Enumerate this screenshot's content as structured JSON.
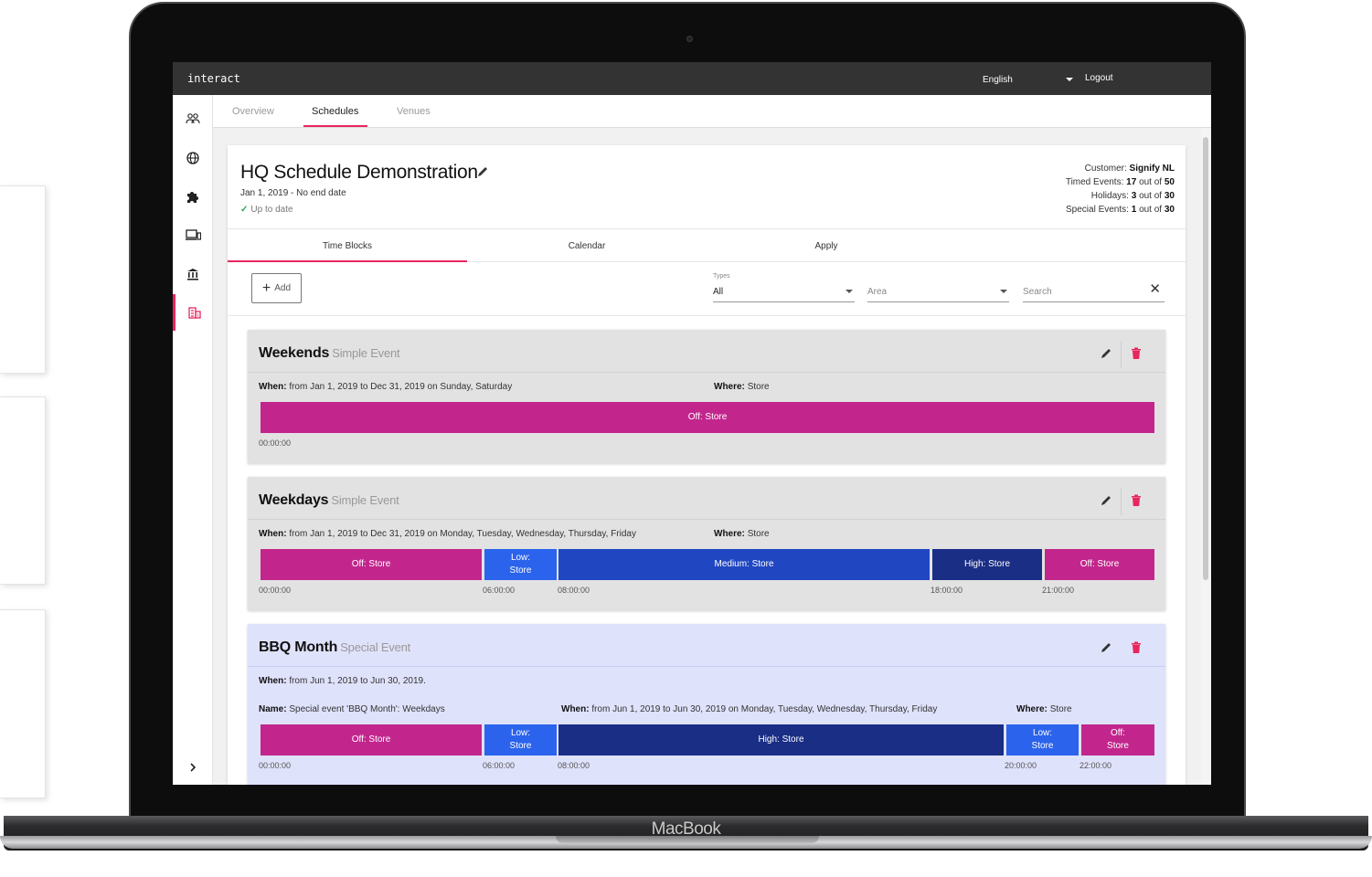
{
  "app": {
    "logo": "interact",
    "language": "English",
    "logout_label": "Logout"
  },
  "device": {
    "brand": "MacBook"
  },
  "sidebar": {
    "items": [
      {
        "icon": "users-icon"
      },
      {
        "icon": "globe-icon"
      },
      {
        "icon": "puzzle-icon"
      },
      {
        "icon": "devices-icon"
      },
      {
        "icon": "bank-icon"
      },
      {
        "icon": "building-icon",
        "active": true
      }
    ],
    "expand_icon": "chevron-right-icon"
  },
  "nav_tabs": [
    {
      "label": "Overview"
    },
    {
      "label": "Schedules",
      "active": true
    },
    {
      "label": "Venues"
    }
  ],
  "schedule": {
    "title": "HQ Schedule Demonstration",
    "date_range": "Jan 1, 2019 - No end date",
    "status": "Up to date",
    "stats": {
      "customer_label": "Customer:",
      "customer_value": "Signify NL",
      "timed_label": "Timed Events:",
      "timed_used": "17",
      "timed_sep": "out of",
      "timed_total": "50",
      "holidays_label": "Holidays:",
      "holidays_used": "3",
      "holidays_sep": "out of",
      "holidays_total": "30",
      "special_label": "Special Events:",
      "special_used": "1",
      "special_sep": "out of",
      "special_total": "30"
    }
  },
  "sub_tabs": [
    {
      "label": "Time Blocks",
      "active": true
    },
    {
      "label": "Calendar"
    },
    {
      "label": "Apply"
    }
  ],
  "toolbar": {
    "add_label": "Add",
    "types_label": "Types",
    "types_value": "All",
    "area_placeholder": "Area",
    "search_placeholder": "Search"
  },
  "colors": {
    "off": "#c2268d",
    "low": "#2b63ec",
    "medium": "#2146c1",
    "high": "#1a2e86",
    "accent": "#e8265e"
  },
  "blocks": [
    {
      "name": "Weekends",
      "type": "Simple Event",
      "when_label": "When:",
      "when": "from Jan 1, 2019 to Dec 31, 2019 on Sunday, Saturday",
      "where_label": "Where:",
      "where": "Store",
      "segments": [
        {
          "line1": "Off: Store",
          "line2": "",
          "level": "off",
          "start": "00:00:00"
        }
      ]
    },
    {
      "name": "Weekdays",
      "type": "Simple Event",
      "when_label": "When:",
      "when": "from Jan 1, 2019 to Dec 31, 2019 on Monday, Tuesday, Wednesday, Thursday, Friday",
      "where_label": "Where:",
      "where": "Store",
      "segments": [
        {
          "line1": "Off: Store",
          "line2": "",
          "level": "off",
          "start": "00:00:00"
        },
        {
          "line1": "Low:",
          "line2": "Store",
          "level": "low",
          "start": "06:00:00"
        },
        {
          "line1": "Medium: Store",
          "line2": "",
          "level": "medium",
          "start": "08:00:00"
        },
        {
          "line1": "High: Store",
          "line2": "",
          "level": "high",
          "start": "18:00:00"
        },
        {
          "line1": "Off: Store",
          "line2": "",
          "level": "off",
          "start": "21:00:00"
        }
      ]
    },
    {
      "name": "BBQ Month",
      "type": "Special Event",
      "when_label": "When:",
      "when": "from Jun 1, 2019 to Jun 30, 2019.",
      "name_label": "Name:",
      "event_name": "Special event 'BBQ Month': Weekdays",
      "when2_label": "When:",
      "when2": "from Jun 1, 2019 to Jun 30, 2019 on Monday, Tuesday, Wednesday, Thursday, Friday",
      "where_label": "Where:",
      "where": "Store",
      "segments": [
        {
          "line1": "Off: Store",
          "line2": "",
          "level": "off",
          "start": "00:00:00"
        },
        {
          "line1": "Low:",
          "line2": "Store",
          "level": "low",
          "start": "06:00:00"
        },
        {
          "line1": "High: Store",
          "line2": "",
          "level": "high",
          "start": "08:00:00"
        },
        {
          "line1": "Low:",
          "line2": "Store",
          "level": "low",
          "start": "20:00:00"
        },
        {
          "line1": "Off:",
          "line2": "Store",
          "level": "off",
          "start": "22:00:00"
        }
      ]
    }
  ]
}
